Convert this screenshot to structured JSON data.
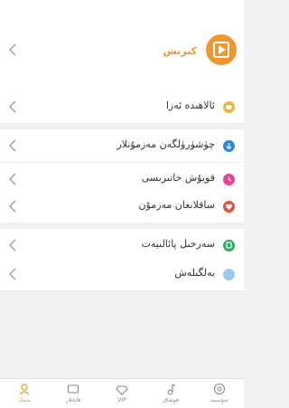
{
  "profile": {
    "login_label": "كىرىش",
    "logo_icon": "orange-video-logo-icon",
    "accent": "#f0962c"
  },
  "menu": [
    {
      "label": "ئالاھىدە ئەزا",
      "icon": "vip-badge-icon",
      "color": "#f2b233"
    },
    {
      "label": "چۈشۈرۈلگەن مەزمۇنلار",
      "icon": "download-icon",
      "color": "#2e86de"
    },
    {
      "label": "قويۇش خاتىرىسى",
      "icon": "history-clock-icon",
      "color": "#e84393"
    },
    {
      "label": "ساقلانغان مەزمۇن",
      "icon": "heart-icon",
      "color": "#e74c3c"
    },
    {
      "label": "سەرخىل پائالىيەت",
      "icon": "activity-flag-icon",
      "color": "#27ae60"
    },
    {
      "label": "بەلگىلەش",
      "icon": "settings-dot-icon",
      "color": "#9fc8f0"
    }
  ],
  "tabbar": {
    "tabs": [
      {
        "label": "مېنىڭ",
        "icon": "person-icon",
        "active": true
      },
      {
        "label": "قانانلار",
        "icon": "tv-channel-icon",
        "active": false
      },
      {
        "label": "VIP",
        "icon": "diamond-icon",
        "active": false
      },
      {
        "label": "قوشاق",
        "icon": "music-note-icon",
        "active": false
      },
      {
        "label": "تەۋسىيە",
        "icon": "home-target-icon",
        "active": false
      }
    ]
  }
}
